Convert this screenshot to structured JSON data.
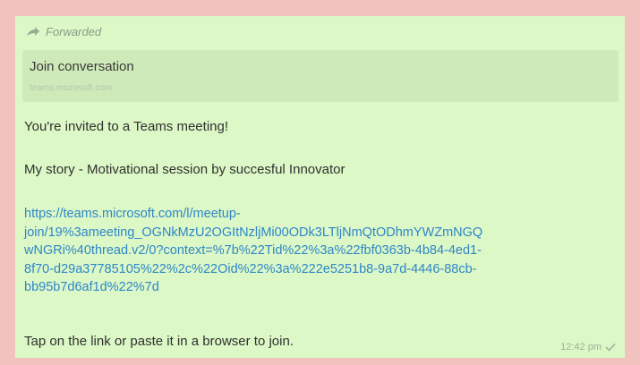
{
  "message": {
    "forwarded_label": "Forwarded",
    "preview": {
      "title": "Join conversation",
      "domain": "teams.microsoft.com"
    },
    "line1": "You're invited to a Teams meeting!",
    "line2": "My story - Motivational session by succesful Innovator",
    "link_lines": [
      "https://teams.microsoft.com/l/meetup-",
      "join/19%3ameeting_OGNkMzU2OGItNzljMi00ODk3LTljNmQtODhmYWZmNGQ",
      "wNGRi%40thread.v2/0?context=%7b%22Tid%22%3a%22fbf0363b-4b84-4ed1-",
      "8f70-d29a37785105%22%2c%22Oid%22%3a%222e5251b8-9a7d-4446-88cb-",
      "bb95b7d6af1d%22%7d"
    ],
    "line3": "Tap on the link or paste it in a browser to join.",
    "time": "12:42 pm"
  },
  "icons": {
    "forward": "forward-arrow-icon",
    "delivered": "single-check-icon"
  },
  "colors": {
    "background": "#f2c2bf",
    "bubble": "#dcf8c6",
    "link": "#2e86c9"
  }
}
